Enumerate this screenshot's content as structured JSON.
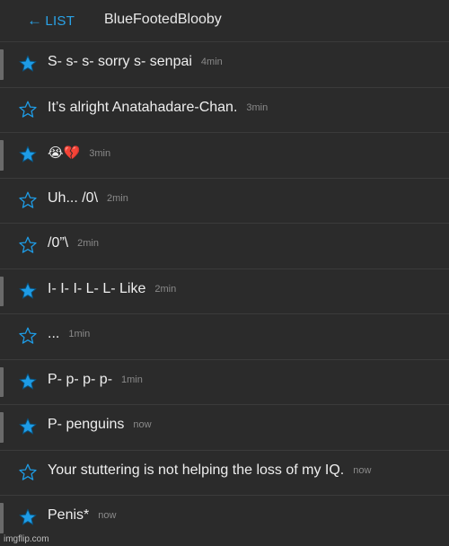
{
  "header": {
    "back_label": "LIST",
    "back_arrow": "←",
    "title": "BlueFootedBlooby"
  },
  "colors": {
    "accent": "#2aa3e8",
    "star_filled": "#1e9ce6",
    "star_outline": "#1e9ce6",
    "background": "#2b2b2b",
    "bar": "#6a6a6a"
  },
  "messages": [
    {
      "text": "S- s- s- sorry s- senpai",
      "time": "4min",
      "star": "filled",
      "bar": true
    },
    {
      "text": "It’s alright Anatahadare-Chan.",
      "time": "3min",
      "star": "outline",
      "bar": false
    },
    {
      "text": "😭💔",
      "time": "3min",
      "star": "filled",
      "bar": true
    },
    {
      "text": "Uh... /0\\",
      "time": "2min",
      "star": "outline",
      "bar": false
    },
    {
      "text": "/0”\\",
      "time": "2min",
      "star": "outline",
      "bar": false
    },
    {
      "text": "I- I- I- L- L- Like",
      "time": "2min",
      "star": "filled",
      "bar": true
    },
    {
      "text": "...",
      "time": "1min",
      "star": "outline",
      "bar": false
    },
    {
      "text": "P- p- p- p-",
      "time": "1min",
      "star": "filled",
      "bar": true
    },
    {
      "text": "P- penguins",
      "time": "now",
      "star": "filled",
      "bar": true
    },
    {
      "text": "Your stuttering is not helping the loss of my IQ.",
      "time": "now",
      "star": "outline",
      "bar": false
    },
    {
      "text": "Penis*",
      "time": "now",
      "star": "filled",
      "bar": true
    }
  ],
  "watermark": "imgflip.com"
}
